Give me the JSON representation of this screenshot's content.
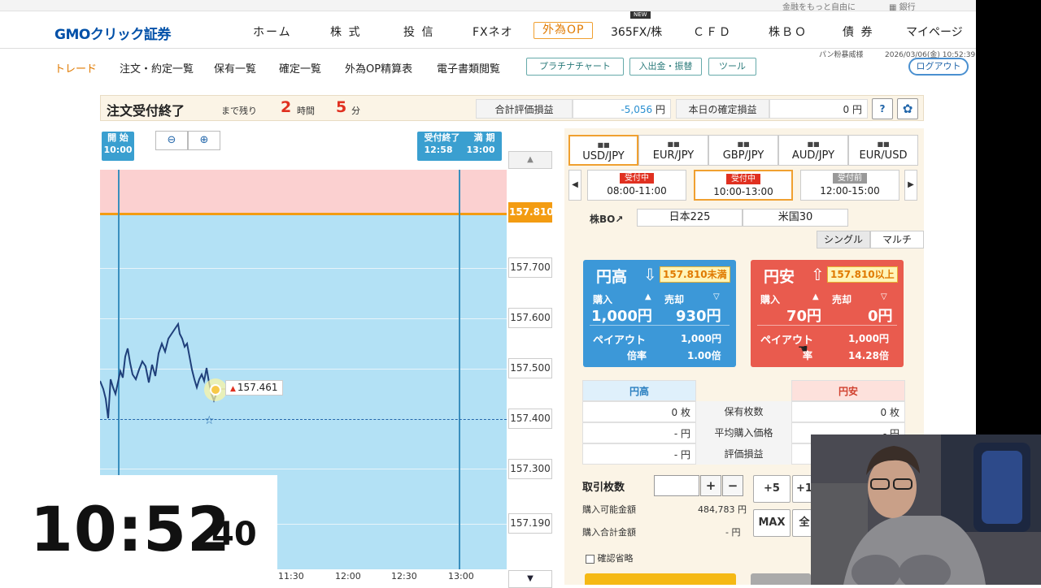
{
  "topstrip": {
    "link1": "金融をもっと自由に",
    "link2": "銀行"
  },
  "brand": {
    "logo": "GMOクリック証券"
  },
  "globalnav": {
    "items": [
      "ホーム",
      "株 式",
      "投 信",
      "FXネオ",
      "外為OP",
      "365FX/株",
      "ＣＦＤ",
      "株ＢＯ",
      "債 券",
      "マイページ"
    ],
    "active": "外為OP",
    "new_badge": "NEW"
  },
  "subnav": {
    "items": [
      "トレード",
      "注文・約定一覧",
      "保有一覧",
      "確定一覧",
      "外為OP精算表",
      "電子書類閲覧"
    ],
    "buttons": [
      "プラチナチャート",
      "入出金・振替",
      "ツール"
    ],
    "logout": "ログアウト",
    "user": "パン粉暴威様",
    "datetime": "2026/03/06(金) 10:52:39"
  },
  "status": {
    "title": "注文受付終了",
    "remaining_label": "まで残り",
    "hours": "2",
    "hours_unit": "時間",
    "minutes": "5",
    "minutes_unit": "分",
    "eval_label": "合計評価損益",
    "eval_value": "-5,056",
    "eval_unit": "円",
    "today_label": "本日の確定損益",
    "today_value": "0",
    "today_unit": "円",
    "help_icon": "question-icon",
    "settings_icon": "gear-icon"
  },
  "chart": {
    "start_label": "開 始",
    "start_time": "10:00",
    "close_label": "受付終了",
    "close_time": "12:58",
    "expiry_label": "満 期",
    "expiry_time": "13:00",
    "current_price": "157.461",
    "target_price": "157.810",
    "y_ticks": [
      "157.810",
      "157.700",
      "157.600",
      "157.500",
      "157.400",
      "157.300",
      "157.190"
    ],
    "x_ticks": [
      "11:30",
      "12:00",
      "12:30",
      "13:00"
    ],
    "colors": {
      "above": "#fbd0d0",
      "below": "#b3e1f5",
      "target_line": "#f39c12",
      "series": "#1f3f7a"
    }
  },
  "clock": {
    "hm": "10:52",
    "sec": "40"
  },
  "pairs": [
    {
      "label": "USD/JPY",
      "flags": "🇺🇸🇯🇵",
      "active": true
    },
    {
      "label": "EUR/JPY",
      "flags": "🇪🇺🇯🇵",
      "active": false
    },
    {
      "label": "GBP/JPY",
      "flags": "🇬🇧🇯🇵",
      "active": false
    },
    {
      "label": "AUD/JPY",
      "flags": "🇦🇺🇯🇵",
      "active": false
    },
    {
      "label": "EUR/USD",
      "flags": "🇪🇺🇺🇸",
      "active": false
    }
  ],
  "slots": [
    {
      "status": "受付中",
      "time": "08:00-11:00"
    },
    {
      "status": "受付中",
      "time": "10:00-13:00"
    },
    {
      "status": "受付前",
      "time": "12:00-15:00"
    }
  ],
  "kabu": {
    "label": "株BO↗",
    "items": [
      "日本225",
      "米国30"
    ]
  },
  "mode": {
    "single": "シングル",
    "multi": "マルチ"
  },
  "cards": {
    "up": {
      "title": "円高",
      "condition": "157.810未満",
      "buy_label": "購入",
      "sell_label": "売却",
      "buy_price": "1,000円",
      "sell_price": "930円",
      "payout_label": "ペイアウト",
      "payout": "1,000円",
      "rate_label": "倍率",
      "rate": "1.00倍"
    },
    "down": {
      "title": "円安",
      "condition": "157.810以上",
      "buy_label": "購入",
      "sell_label": "売却",
      "buy_price": "70円",
      "sell_price": "0円",
      "payout_label": "ペイアウト",
      "payout": "1,000円",
      "rate_label": "率",
      "rate": "14.28倍"
    }
  },
  "positions": {
    "up_header": "円高",
    "down_header": "円安",
    "rows": [
      {
        "label": "保有枚数",
        "up": "0 枚",
        "down": "0 枚"
      },
      {
        "label": "平均購入価格",
        "up": "- 円",
        "down": "- 円"
      },
      {
        "label": "評価損益",
        "up": "- 円",
        "down": ""
      }
    ]
  },
  "order": {
    "qty_label": "取引枚数",
    "qty_value": "",
    "plus": "+",
    "minus": "−",
    "plus5": "+5",
    "plus10": "+1",
    "max": "MAX",
    "all": "全",
    "available_label": "購入可能金額",
    "available": "484,783 円",
    "total_label": "購入合計金額",
    "total": "- 円",
    "confirm_skip": "確認省略"
  }
}
